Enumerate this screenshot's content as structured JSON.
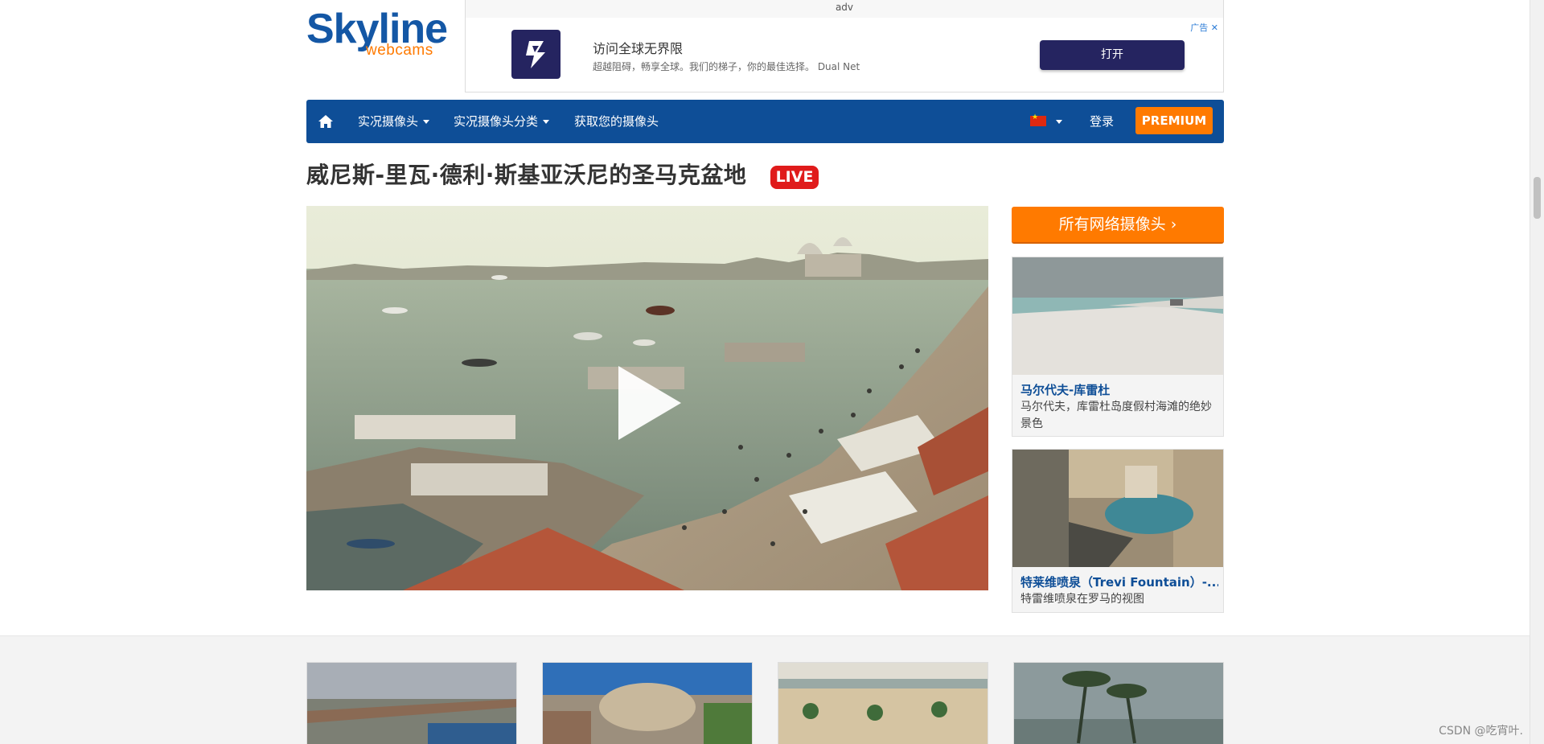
{
  "brand": {
    "name": "Skyline",
    "sub": "webcams"
  },
  "ad": {
    "label": "adv",
    "title": "访问全球无界限",
    "description": "超越阻碍，畅享全球。我们的梯子，你的最佳选择。 Dual Net",
    "button": "打开",
    "tag": "广告 ✕",
    "logo_icon": "dual-net-logo"
  },
  "nav": {
    "home_icon": "home-icon",
    "items": [
      {
        "label": "实况摄像头",
        "dropdown": true
      },
      {
        "label": "实况摄像头分类",
        "dropdown": true
      },
      {
        "label": "获取您的摄像头",
        "dropdown": false
      }
    ],
    "language_flag": "china-flag",
    "login": "登录",
    "premium": "PREMIUM"
  },
  "page": {
    "title": "威尼斯-里瓦·德利·斯基亚沃尼的圣马克盆地",
    "live": "LIVE"
  },
  "sidebar": {
    "all_webcams": "所有网络摄像头 ›",
    "cards": [
      {
        "title": "马尔代夫-库雷杜",
        "description": "马尔代夫，库雷杜岛度假村海滩的绝妙景色"
      },
      {
        "title": "特莱维喷泉（Trevi Fountain）-...",
        "description": "特雷维喷泉在罗马的视图"
      }
    ]
  },
  "footer": {
    "watermark": "CSDN @吃宵叶."
  },
  "colors": {
    "brand_blue": "#0e4e97",
    "accent_orange": "#ff7a00",
    "live_red": "#e01b1b",
    "ad_navy": "#252460"
  }
}
